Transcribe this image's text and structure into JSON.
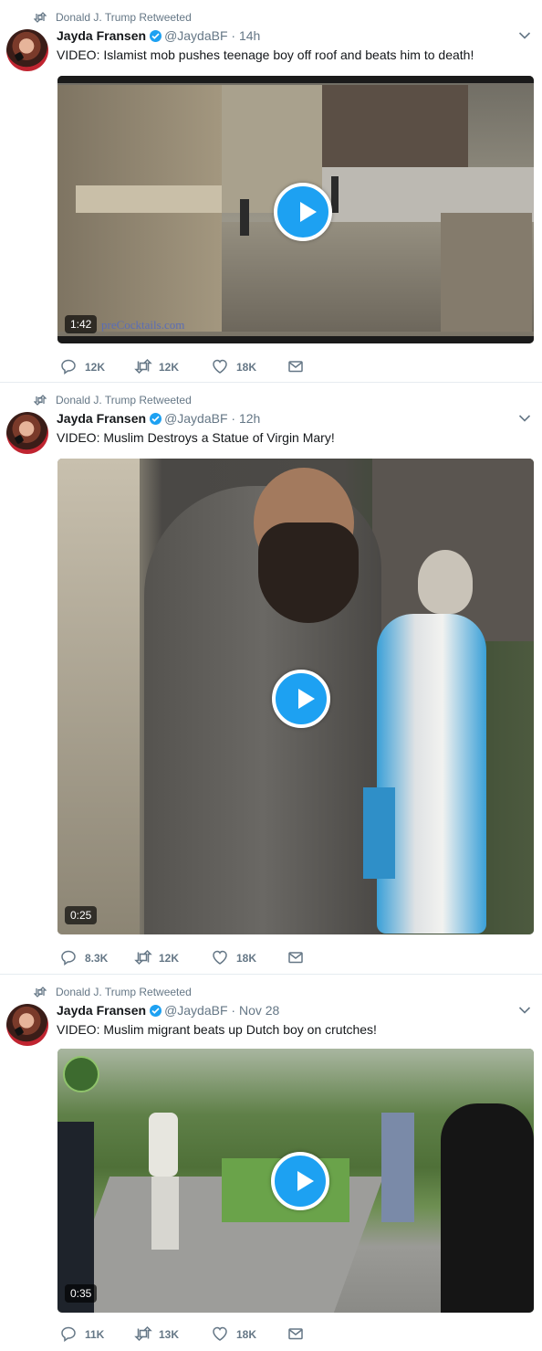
{
  "tweets": [
    {
      "retweeted_by": "Donald J. Trump Retweeted",
      "author": {
        "name": "Jayda Fransen",
        "handle": "@JaydaBF"
      },
      "time": "14h",
      "text": "VIDEO: Islamist mob pushes teenage boy off roof and beats him to death!",
      "video": {
        "duration": "1:42",
        "watermark": "preCocktails.com"
      },
      "stats": {
        "replies": "12K",
        "retweets": "12K",
        "likes": "18K"
      }
    },
    {
      "retweeted_by": "Donald J. Trump Retweeted",
      "author": {
        "name": "Jayda Fransen",
        "handle": "@JaydaBF"
      },
      "time": "12h",
      "text": "VIDEO: Muslim Destroys a Statue of Virgin Mary!",
      "video": {
        "duration": "0:25"
      },
      "stats": {
        "replies": "8.3K",
        "retweets": "12K",
        "likes": "18K"
      }
    },
    {
      "retweeted_by": "Donald J. Trump Retweeted",
      "author": {
        "name": "Jayda Fransen",
        "handle": "@JaydaBF"
      },
      "time": "Nov 28",
      "text": "VIDEO: Muslim migrant beats up Dutch boy on crutches!",
      "video": {
        "duration": "0:35"
      },
      "stats": {
        "replies": "11K",
        "retweets": "13K",
        "likes": "18K"
      }
    }
  ],
  "separator": "·",
  "icons": [
    "retweet-icon",
    "verified-badge-icon",
    "chevron-down-icon",
    "play-icon",
    "reply-icon",
    "heart-icon",
    "envelope-icon"
  ],
  "colors": {
    "accent": "#1da1f2",
    "secondary_text": "#657786",
    "border": "#e6ecf0"
  }
}
